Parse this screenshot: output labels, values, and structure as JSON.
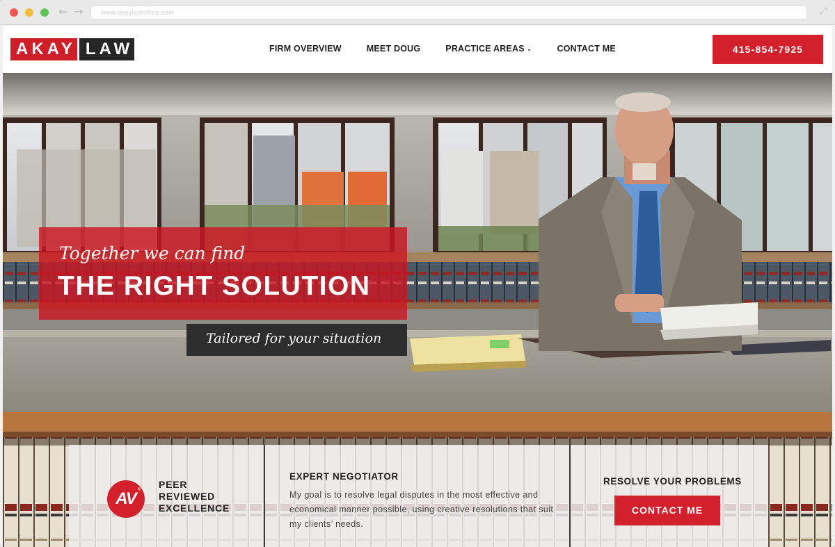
{
  "browser": {
    "url": "www.akaylawoffice.com",
    "nav_back": "←",
    "nav_forward": "→",
    "expand": "⤢"
  },
  "header": {
    "logo_left": "AKAY",
    "logo_right": "LAW",
    "nav": {
      "firm_overview": "FIRM OVERVIEW",
      "meet_doug": "MEET DOUG",
      "practice_areas": "PRACTICE AREAS",
      "contact_me": "CONTACT ME"
    },
    "phone": "415-854-7925"
  },
  "hero": {
    "tagline_script": "Together we can find",
    "headline": "THE RIGHT SOLUTION",
    "subline": "Tailored for your situation"
  },
  "features": {
    "badge_mark": "AV",
    "badge_reg": "®",
    "peer_line1": "PEER",
    "peer_line2": "REVIEWED",
    "peer_line3": "EXCELLENCE",
    "negotiator_title": "EXPERT NEGOTIATOR",
    "negotiator_body": "My goal is to resolve legal disputes in the most effective and economical manner possible, using creative resolutions that suit my clients’ needs.",
    "resolve_title": "RESOLVE YOUR PROBLEMS",
    "contact_button": "CONTACT ME"
  },
  "colors": {
    "brand_red": "#d2202c",
    "logo_dark": "#262626",
    "strip_bg": "#ececec"
  }
}
